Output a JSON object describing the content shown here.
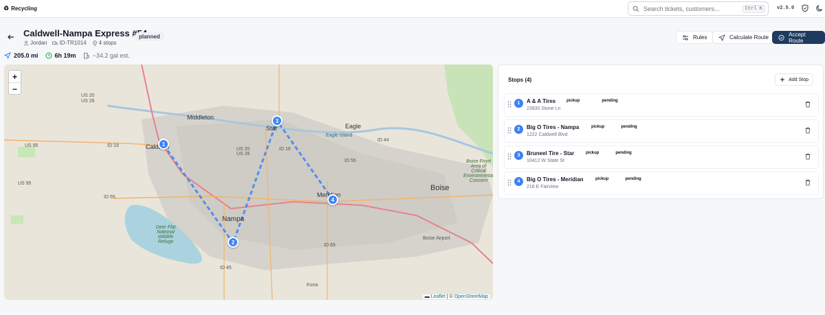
{
  "app": {
    "name": "Recycling",
    "version": "v2.5.0"
  },
  "search": {
    "placeholder": "Search tickets, customers...",
    "shortcut": "Ctrl K"
  },
  "route": {
    "title": "Caldwell-Nampa Express #54",
    "status": "planned",
    "driver": "Jordan",
    "truck": "ID-TR1014",
    "stops_count": "4 stops",
    "distance": "205.0 mi",
    "duration": "6h 19m",
    "fuel": "~34.2 gal est."
  },
  "actions": {
    "rules": "Rules",
    "calculate": "Calculate Route",
    "accept": "Accept Route"
  },
  "map": {
    "zoom_in": "+",
    "zoom_out": "−",
    "attribution_leaflet": "Leaflet",
    "attribution_sep": " | © ",
    "attribution_osm": "OpenStreetMap",
    "cities": [
      "Middleton",
      "Caldwell",
      "Star",
      "Eagle",
      "Eagle Island",
      "Meridian",
      "Boise",
      "Nampa",
      "Kuna",
      "Boise Airport",
      "Deer Flat National Wildlife Refuge",
      "Boise Front Area of Critical Environmental Concern"
    ],
    "highways": [
      "US 20",
      "US 26",
      "US 95",
      "ID 19",
      "US 20",
      "US 26",
      "ID 16",
      "ID 44",
      "ID 55",
      "ID 55",
      "ID 69",
      "ID 45",
      "US 95"
    ]
  },
  "stops_panel": {
    "title": "Stops (4)",
    "add_label": "Add Stop",
    "stops": [
      {
        "num": "1",
        "name": "A & A Tires",
        "type": "pickup",
        "status": "pending",
        "address": "23930 Stone Ln"
      },
      {
        "num": "2",
        "name": "Big O Tires - Nampa",
        "type": "pickup",
        "status": "pending",
        "address": "1222 Caldwell Blvd"
      },
      {
        "num": "3",
        "name": "Bruneel Tire - Star",
        "type": "pickup",
        "status": "pending",
        "address": "10412 W State St"
      },
      {
        "num": "4",
        "name": "Big O Tires - Meridian",
        "type": "pickup",
        "status": "pending",
        "address": "216 E Fairview"
      }
    ]
  },
  "colors": {
    "accent": "#1e3a5f",
    "marker": "#3b82f6",
    "route_line": "#3b82f6"
  }
}
